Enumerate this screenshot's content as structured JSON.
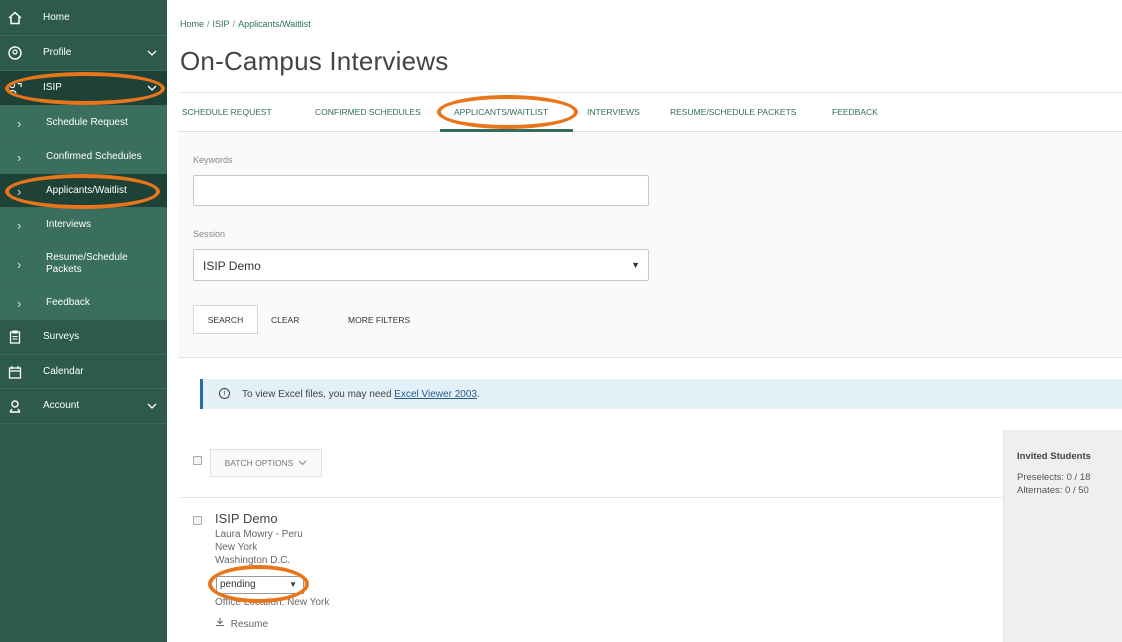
{
  "sidebar": {
    "items": [
      {
        "label": "Home",
        "icon": "home-icon"
      },
      {
        "label": "Profile",
        "icon": "profile-icon",
        "expandable": true
      },
      {
        "label": "ISIP",
        "icon": "isip-icon",
        "expandable": true
      },
      {
        "label": "Schedule Request"
      },
      {
        "label": "Confirmed Schedules"
      },
      {
        "label": "Applicants/Waitlist",
        "active": true
      },
      {
        "label": "Interviews"
      },
      {
        "label": "Resume/Schedule Packets"
      },
      {
        "label": "Feedback"
      },
      {
        "label": "Surveys",
        "icon": "clipboard-icon"
      },
      {
        "label": "Calendar",
        "icon": "calendar-icon"
      },
      {
        "label": "Account",
        "icon": "account-icon",
        "expandable": true
      }
    ]
  },
  "breadcrumb": {
    "home": "Home",
    "section": "ISIP",
    "current": "Applicants/Waitlist",
    "separator": "/"
  },
  "page": {
    "title": "On-Campus Interviews"
  },
  "tabs": [
    {
      "label": "SCHEDULE REQUEST"
    },
    {
      "label": "CONFIRMED SCHEDULES"
    },
    {
      "label": "APPLICANTS/WAITLIST",
      "active": true
    },
    {
      "label": "INTERVIEWS"
    },
    {
      "label": "RESUME/SCHEDULE PACKETS"
    },
    {
      "label": "FEEDBACK"
    }
  ],
  "filters": {
    "keywords_label": "Keywords",
    "keywords_value": "",
    "session_label": "Session",
    "session_value": "ISIP Demo",
    "search_button": "SEARCH",
    "clear_button": "CLEAR",
    "more_filters_button": "MORE FILTERS"
  },
  "info": {
    "text": "To view Excel files, you may need ",
    "link": "Excel Viewer 2003",
    "suffix": "."
  },
  "batch": {
    "label": "BATCH OPTIONS"
  },
  "result": {
    "title": "ISIP Demo",
    "name_line": "Laura Mowry - Peru",
    "location1": "New York",
    "location2": "Washington D.C.",
    "status_value": "pending",
    "office_location": "Office Location: New York",
    "resume_link": "Resume"
  },
  "side_panel": {
    "title": "Invited Students",
    "preselects": "Preselects: 0 / 18",
    "alternates": "Alternates: 0 / 50"
  },
  "colors": {
    "sidebar_bg": "#2d5a4c",
    "sidebar_sub_bg": "#3a6e5e",
    "accent": "#2f6e5e",
    "annotation": "#e8751a",
    "info_bg": "#e3f0f8"
  }
}
